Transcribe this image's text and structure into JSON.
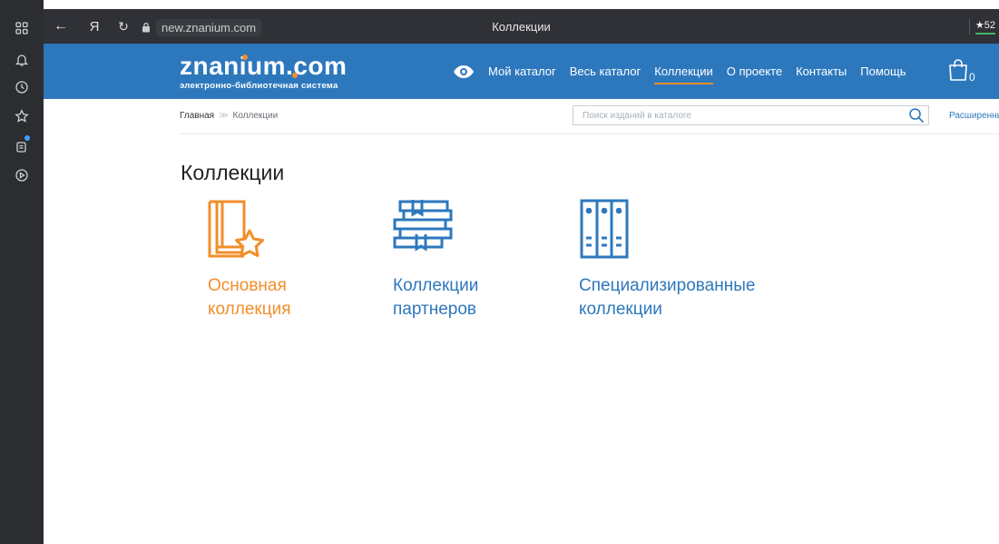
{
  "browser": {
    "url": "new.znanium.com",
    "tab_title": "Коллекции",
    "rating": "★52",
    "back_glyph": "←",
    "yandex_glyph": "Я",
    "reload_glyph": "↻"
  },
  "site": {
    "logo_name": "znanium.com",
    "logo_subtitle": "электронно-библиотечная система",
    "nav": [
      {
        "label": "Мой каталог"
      },
      {
        "label": "Весь каталог"
      },
      {
        "label": "Коллекции",
        "active": true
      },
      {
        "label": "О проекте"
      },
      {
        "label": "Контакты"
      },
      {
        "label": "Помощь"
      }
    ],
    "cart_count": "0"
  },
  "breadcrumb": {
    "home": "Главная",
    "separator": "≫",
    "current": "Коллекции"
  },
  "search": {
    "placeholder": "Поиск изданий в каталоге",
    "advanced_label": "Расширенный"
  },
  "page_title": "Коллекции",
  "collections": [
    {
      "line1": "Основная",
      "line2": "коллекция",
      "icon": "book-star-icon"
    },
    {
      "line1": "Коллекции",
      "line2": "партнеров",
      "icon": "books-stack-icon"
    },
    {
      "line1": "Специализированные",
      "line2": "коллекции",
      "icon": "archive-binders-icon"
    }
  ],
  "colors": {
    "brand_blue": "#2d78bd",
    "accent_orange": "#f28e2b",
    "browser_dark": "#2b2d31"
  }
}
